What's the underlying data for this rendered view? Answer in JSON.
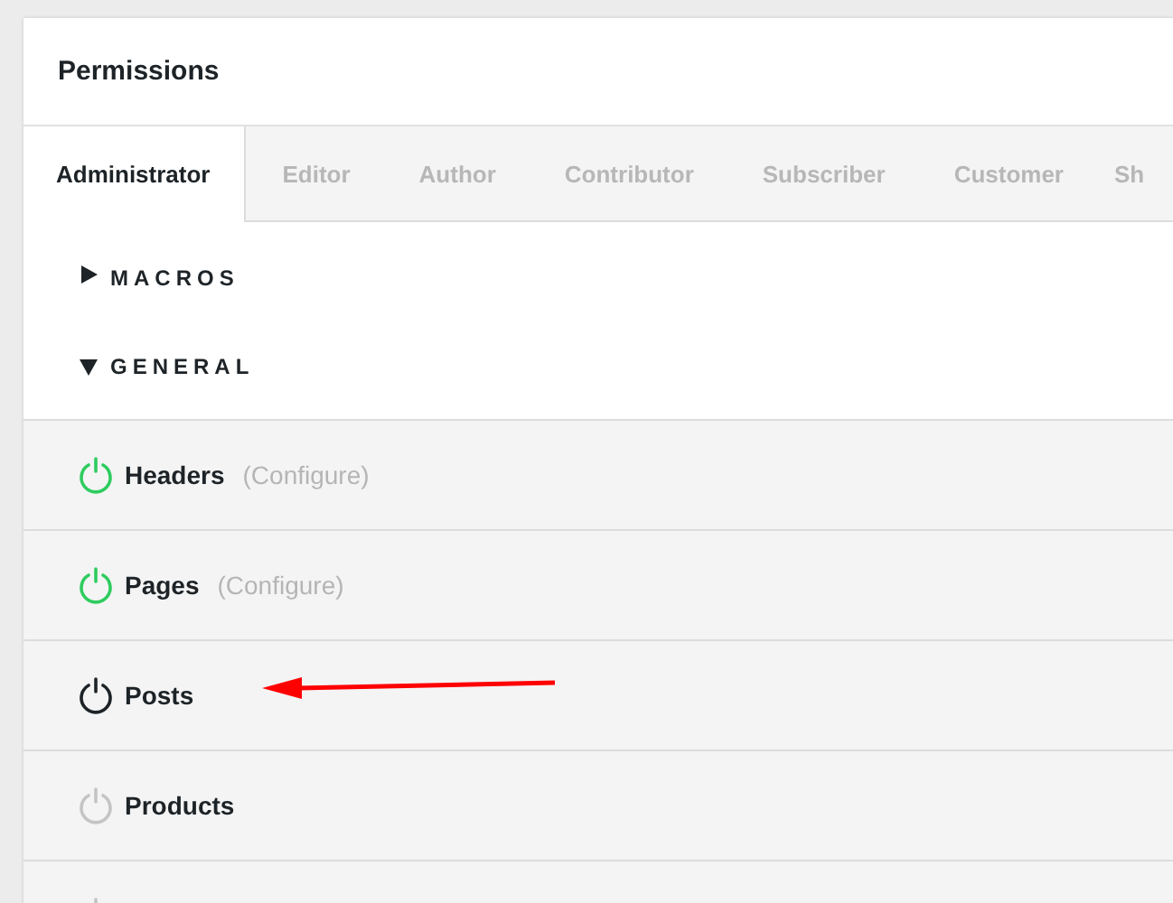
{
  "panel": {
    "title": "Permissions"
  },
  "tabs": [
    {
      "label": "Administrator",
      "selected": true
    },
    {
      "label": "Editor",
      "selected": false
    },
    {
      "label": "Author",
      "selected": false
    },
    {
      "label": "Contributor",
      "selected": false
    },
    {
      "label": "Subscriber",
      "selected": false
    },
    {
      "label": "Customer",
      "selected": false
    },
    {
      "label": "Sh",
      "selected": false
    }
  ],
  "groups": [
    {
      "label": "MACROS",
      "expanded": false
    },
    {
      "label": "GENERAL",
      "expanded": true
    }
  ],
  "permissions": [
    {
      "label": "Headers",
      "kind": "on",
      "link": "(Configure)"
    },
    {
      "label": "Pages",
      "kind": "on",
      "link": "(Configure)"
    },
    {
      "label": "Posts",
      "kind": "focus"
    },
    {
      "label": "Products",
      "kind": "off"
    },
    {
      "kind": "off"
    }
  ]
}
